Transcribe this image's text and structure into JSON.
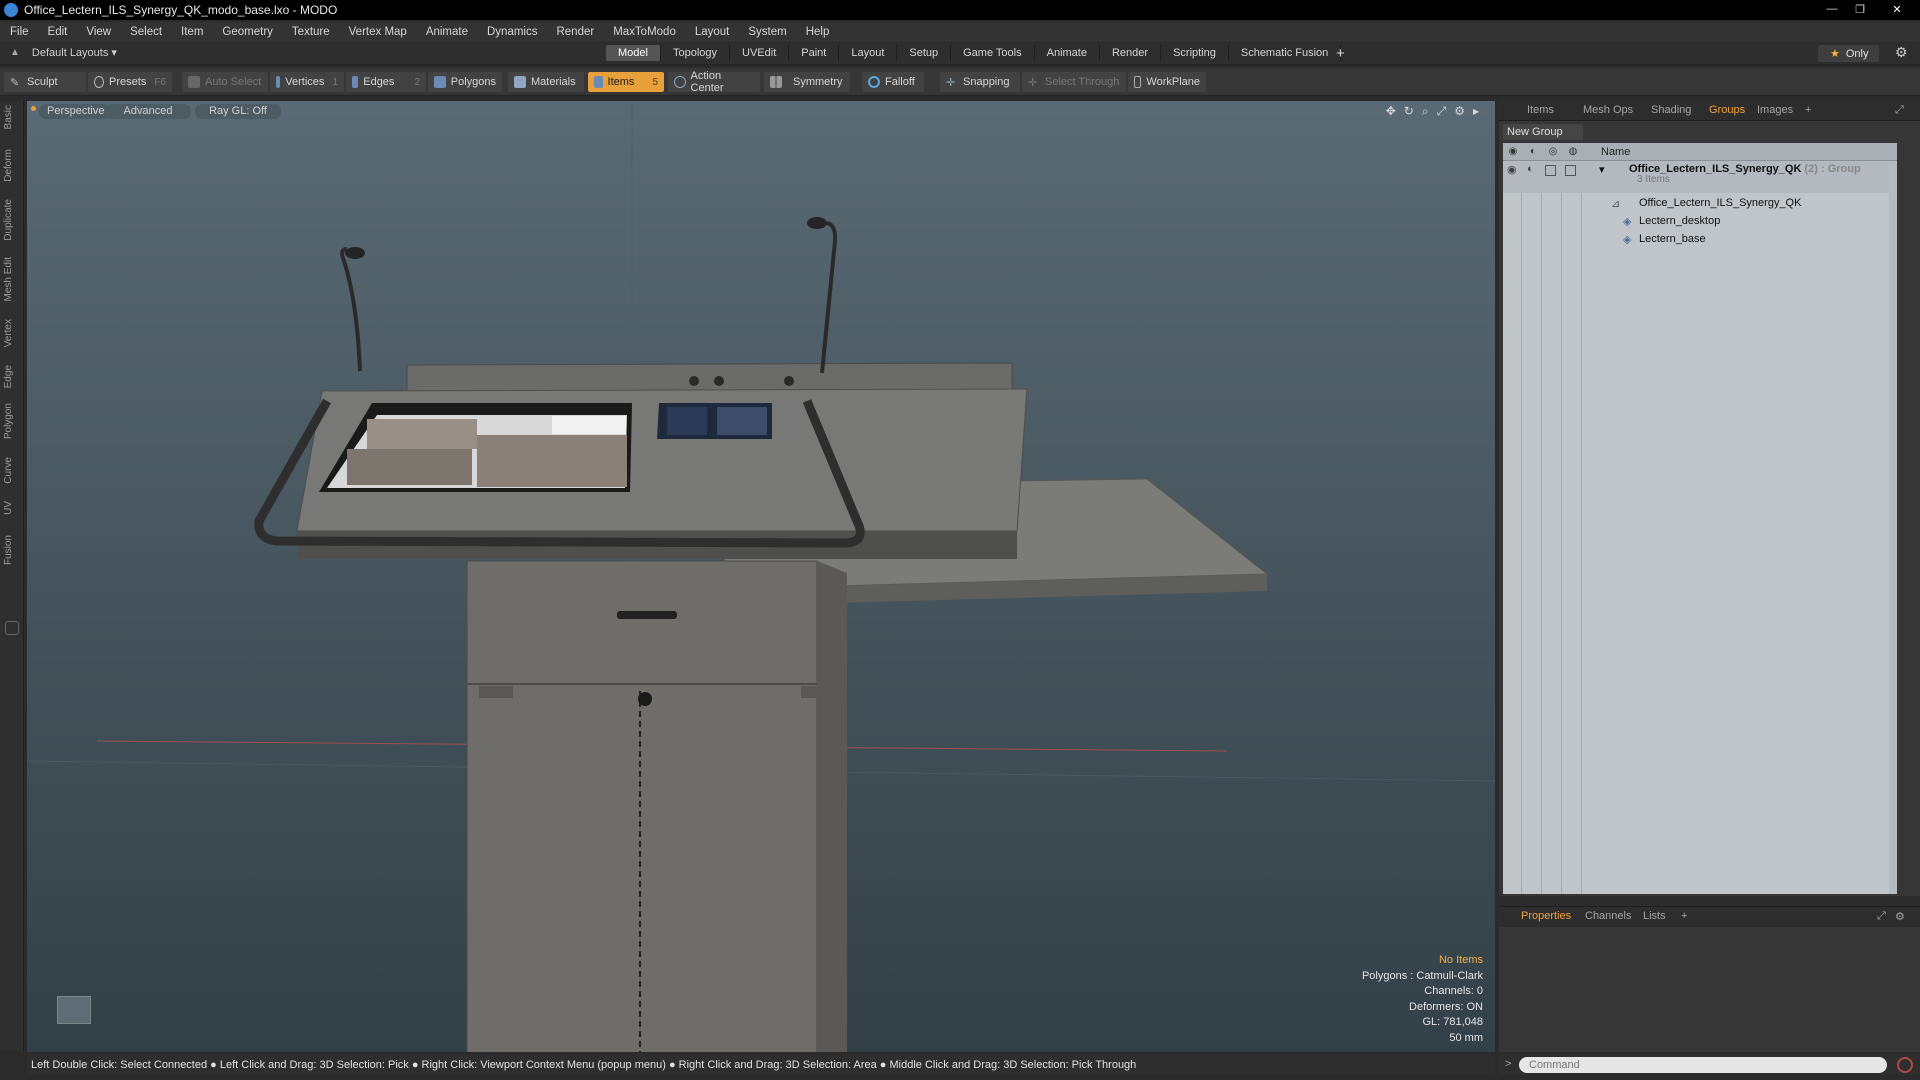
{
  "window": {
    "title": "Office_Lectern_ILS_Synergy_QK_modo_base.lxo - MODO",
    "controls": [
      "—",
      "❐",
      "✕"
    ]
  },
  "menu": [
    "File",
    "Edit",
    "View",
    "Select",
    "Item",
    "Geometry",
    "Texture",
    "Vertex Map",
    "Animate",
    "Dynamics",
    "Render",
    "MaxToModo",
    "Layout",
    "System",
    "Help"
  ],
  "layout_bar": {
    "layouts_label": "Default Layouts ▾",
    "tabs": [
      "Model",
      "Topology",
      "UVEdit",
      "Paint",
      "Layout",
      "Setup",
      "Game Tools",
      "Animate",
      "Render",
      "Scripting",
      "Schematic Fusion"
    ],
    "active_tab": "Model",
    "add": "+",
    "only": "Only"
  },
  "toolbar": {
    "sculpt": "Sculpt",
    "presets": "Presets",
    "presets_key": "F6",
    "auto_select": "Auto Select",
    "vertices": "Vertices",
    "vertices_count": "1",
    "edges": "Edges",
    "edges_count": "2",
    "polygons": "Polygons",
    "materials": "Materials",
    "items": "Items",
    "items_count": "5",
    "action_center": "Action Center",
    "symmetry": "Symmetry",
    "falloff": "Falloff",
    "snapping": "Snapping",
    "select_through": "Select Through",
    "workplane": "WorkPlane"
  },
  "left_tabs": [
    "Basic",
    "Deform",
    "Duplicate",
    "Mesh Edit",
    "Vertex",
    "Edge",
    "Polygon",
    "Curve",
    "UV",
    "Fusion"
  ],
  "viewport": {
    "view": "Perspective",
    "mode": "Advanced",
    "raygl": "Ray GL: Off",
    "info": {
      "selection": "No Items",
      "polygons": "Polygons : Catmull-Clark",
      "channels": "Channels: 0",
      "deformers": "Deformers: ON",
      "gl": "GL: 781,048",
      "scale": "50 mm"
    }
  },
  "right_panel": {
    "tabs": [
      "Items",
      "Mesh Ops",
      "Shading",
      "Groups",
      "Images",
      "+"
    ],
    "active_tab": "Groups",
    "new_group": "New Group",
    "column_name": "Name",
    "group": {
      "name": "Office_Lectern_ILS_Synergy_QK",
      "count": "(2)",
      "type": ": Group",
      "items_label": "3 Items",
      "children": [
        "Office_Lectern_ILS_Synergy_QK",
        "Lectern_desktop",
        "Lectern_base"
      ]
    }
  },
  "bottom_panel": {
    "tabs": [
      "Properties",
      "Channels",
      "Lists",
      "+"
    ],
    "active_tab": "Properties"
  },
  "status": "Left Double Click: Select Connected ● Left Click and Drag: 3D Selection: Pick ● Right Click: Viewport Context Menu (popup menu) ● Right Click and Drag: 3D Selection: Area ● Middle Click and Drag: 3D Selection: Pick Through",
  "command": {
    "placeholder": "Command"
  },
  "colors": {
    "accent": "#f2a43d",
    "items_active": "#e8a13a"
  }
}
